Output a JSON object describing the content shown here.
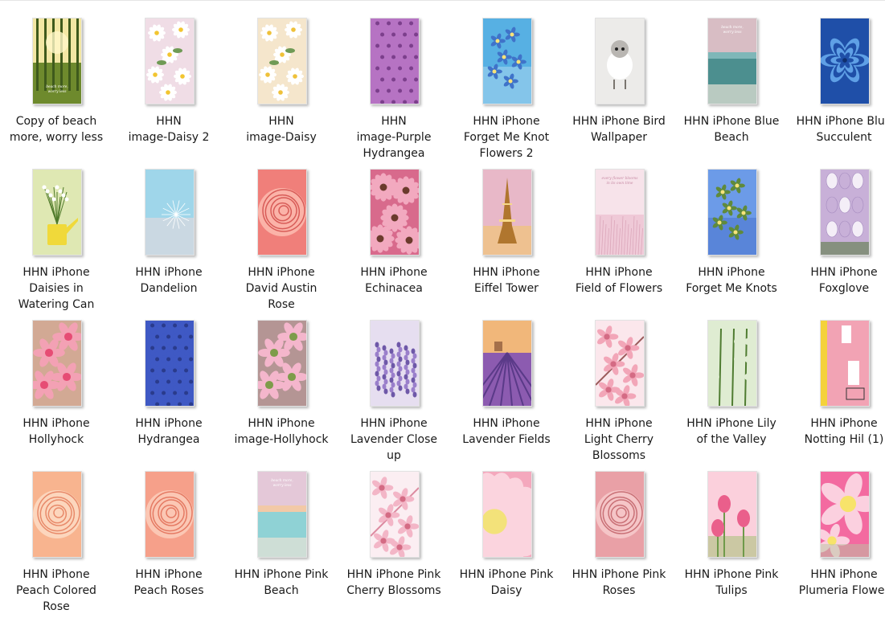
{
  "files": [
    {
      "name": "Copy of beach\nmore, worry less",
      "icon": "forest-sunlight-thumbnail",
      "colors": [
        "#f3e7a4",
        "#6e8a2d",
        "#3f5a1c"
      ],
      "overlay_text": "beach more,\nworry less"
    },
    {
      "name": "HHN\nimage-Daisy 2",
      "icon": "daisy-thumbnail",
      "colors": [
        "#f0dde6",
        "#ffffff",
        "#f2c530"
      ]
    },
    {
      "name": "HHN\nimage-Daisy",
      "icon": "daisy-thumbnail",
      "colors": [
        "#f5e6cc",
        "#ffffff",
        "#efc13a"
      ]
    },
    {
      "name": "HHN\nimage-Purple\nHydrangea",
      "icon": "hydrangea-thumbnail",
      "colors": [
        "#b673c3",
        "#d9a6df",
        "#7c3f8c"
      ]
    },
    {
      "name": "HHN iPhone\nForget Me Knot\nFlowers 2",
      "icon": "forget-me-not-thumbnail",
      "colors": [
        "#57b0e3",
        "#c9e6f5",
        "#3f73c9"
      ]
    },
    {
      "name": "HHN iPhone Bird\nWallpaper",
      "icon": "bird-thumbnail",
      "colors": [
        "#ecebe9",
        "#b9b6b2",
        "#7a756f"
      ]
    },
    {
      "name": "HHN iPhone Blue\nBeach",
      "icon": "beach-thumbnail",
      "colors": [
        "#d8bdc4",
        "#7fb7b8",
        "#4c8f8f"
      ],
      "overlay_text": "beach more,\nworry less"
    },
    {
      "name": "HHN iPhone Blue\nSucculent",
      "icon": "succulent-thumbnail",
      "colors": [
        "#1f4fa8",
        "#5fa0e6",
        "#0f2f6e"
      ]
    },
    {
      "name": "HHN iPhone\nDaisies in\nWatering Can",
      "icon": "watering-can-thumbnail",
      "colors": [
        "#dfe8b3",
        "#f0d93a",
        "#4f7a2a"
      ]
    },
    {
      "name": "HHN iPhone\nDandelion",
      "icon": "dandelion-thumbnail",
      "colors": [
        "#9fd6ea",
        "#e8d8dc",
        "#ffffff"
      ]
    },
    {
      "name": "HHN iPhone\nDavid Austin\nRose",
      "icon": "rose-thumbnail",
      "colors": [
        "#f07f7a",
        "#fbb3a8",
        "#d85c58"
      ]
    },
    {
      "name": "HHN iPhone\nEchinacea",
      "icon": "echinacea-thumbnail",
      "colors": [
        "#d86a8c",
        "#f2a9bf",
        "#6b3a2c"
      ]
    },
    {
      "name": "HHN iPhone\nEiffel Tower",
      "icon": "eiffel-tower-thumbnail",
      "colors": [
        "#e8b8c8",
        "#f2c66b",
        "#b0762e"
      ]
    },
    {
      "name": "HHN iPhone\nField of Flowers",
      "icon": "field-of-flowers-thumbnail",
      "colors": [
        "#f7e3ea",
        "#eab7c9",
        "#ffffff"
      ],
      "overlay_text": "every flower blooms\nin its own time"
    },
    {
      "name": "HHN iPhone\nForget Me Knots",
      "icon": "forget-me-not-thumbnail",
      "colors": [
        "#6c9be8",
        "#3f64c2",
        "#5f8a3c"
      ]
    },
    {
      "name": "HHN iPhone\nFoxglove",
      "icon": "foxglove-thumbnail",
      "colors": [
        "#c8b0d8",
        "#f4eef7",
        "#5a7b44"
      ]
    },
    {
      "name": "HHN iPhone\nHollyhock",
      "icon": "hollyhock-thumbnail",
      "colors": [
        "#f3a1b4",
        "#e64c74",
        "#95b65a"
      ]
    },
    {
      "name": "HHN iPhone\nHydrangea",
      "icon": "hydrangea-thumbnail",
      "colors": [
        "#3f59c4",
        "#7d8fe0",
        "#2a3b8c"
      ]
    },
    {
      "name": "HHN iPhone\nimage-Hollyhock",
      "icon": "hollyhock-thumbnail",
      "colors": [
        "#f4b6cc",
        "#7d9c4a",
        "#3c5a2a"
      ]
    },
    {
      "name": "HHN iPhone\nLavender Close\nup",
      "icon": "lavender-thumbnail",
      "colors": [
        "#e6def0",
        "#9a7fcb",
        "#6e58a8"
      ]
    },
    {
      "name": "HHN iPhone\nLavender Fields",
      "icon": "lavender-field-thumbnail",
      "colors": [
        "#f1b77a",
        "#8c5bb0",
        "#5a3a88"
      ]
    },
    {
      "name": "HHN iPhone\nLight Cherry\nBlossoms",
      "icon": "cherry-blossom-thumbnail",
      "colors": [
        "#fbe7ec",
        "#f2a6b8",
        "#9a5a5a"
      ]
    },
    {
      "name": "HHN iPhone Lily\nof the Valley",
      "icon": "lily-of-the-valley-thumbnail",
      "colors": [
        "#ffffff",
        "#7fb24a",
        "#3f6a28"
      ]
    },
    {
      "name": "HHN iPhone\nNotting Hil (1)",
      "icon": "notting-hill-thumbnail",
      "colors": [
        "#f2a3b4",
        "#f4d23b",
        "#ffffff"
      ]
    },
    {
      "name": "HHN iPhone\nPeach Colored\nRose",
      "icon": "rose-thumbnail",
      "colors": [
        "#f8b48f",
        "#fcd6bd",
        "#e88a6a"
      ]
    },
    {
      "name": "HHN iPhone\nPeach Roses",
      "icon": "rose-thumbnail",
      "colors": [
        "#f6a08a",
        "#fbc7b4",
        "#e57a63"
      ]
    },
    {
      "name": "HHN iPhone Pink\nBeach",
      "icon": "beach-thumbnail",
      "colors": [
        "#e4c8d8",
        "#f2c9a7",
        "#8fd2d5"
      ],
      "overlay_text": "beach more,\nworry less"
    },
    {
      "name": "HHN iPhone Pink\nCherry Blossoms",
      "icon": "cherry-blossom-thumbnail",
      "colors": [
        "#fbeef2",
        "#f3b6c7",
        "#dc8aa0"
      ]
    },
    {
      "name": "HHN iPhone Pink\nDaisy",
      "icon": "pink-daisy-thumbnail",
      "colors": [
        "#f4a8bd",
        "#fbd4de",
        "#f3e27a"
      ]
    },
    {
      "name": "HHN iPhone Pink\nRoses",
      "icon": "rose-thumbnail",
      "colors": [
        "#e9a0a6",
        "#f5c5c7",
        "#c97076"
      ]
    },
    {
      "name": "HHN iPhone Pink\nTulips",
      "icon": "tulip-thumbnail",
      "colors": [
        "#fbd0dc",
        "#ea5f8b",
        "#9bbf6a"
      ]
    },
    {
      "name": "HHN iPhone\nPlumeria Flower",
      "icon": "plumeria-thumbnail",
      "colors": [
        "#f36aa0",
        "#fbd0df",
        "#b9c6a2"
      ]
    }
  ]
}
